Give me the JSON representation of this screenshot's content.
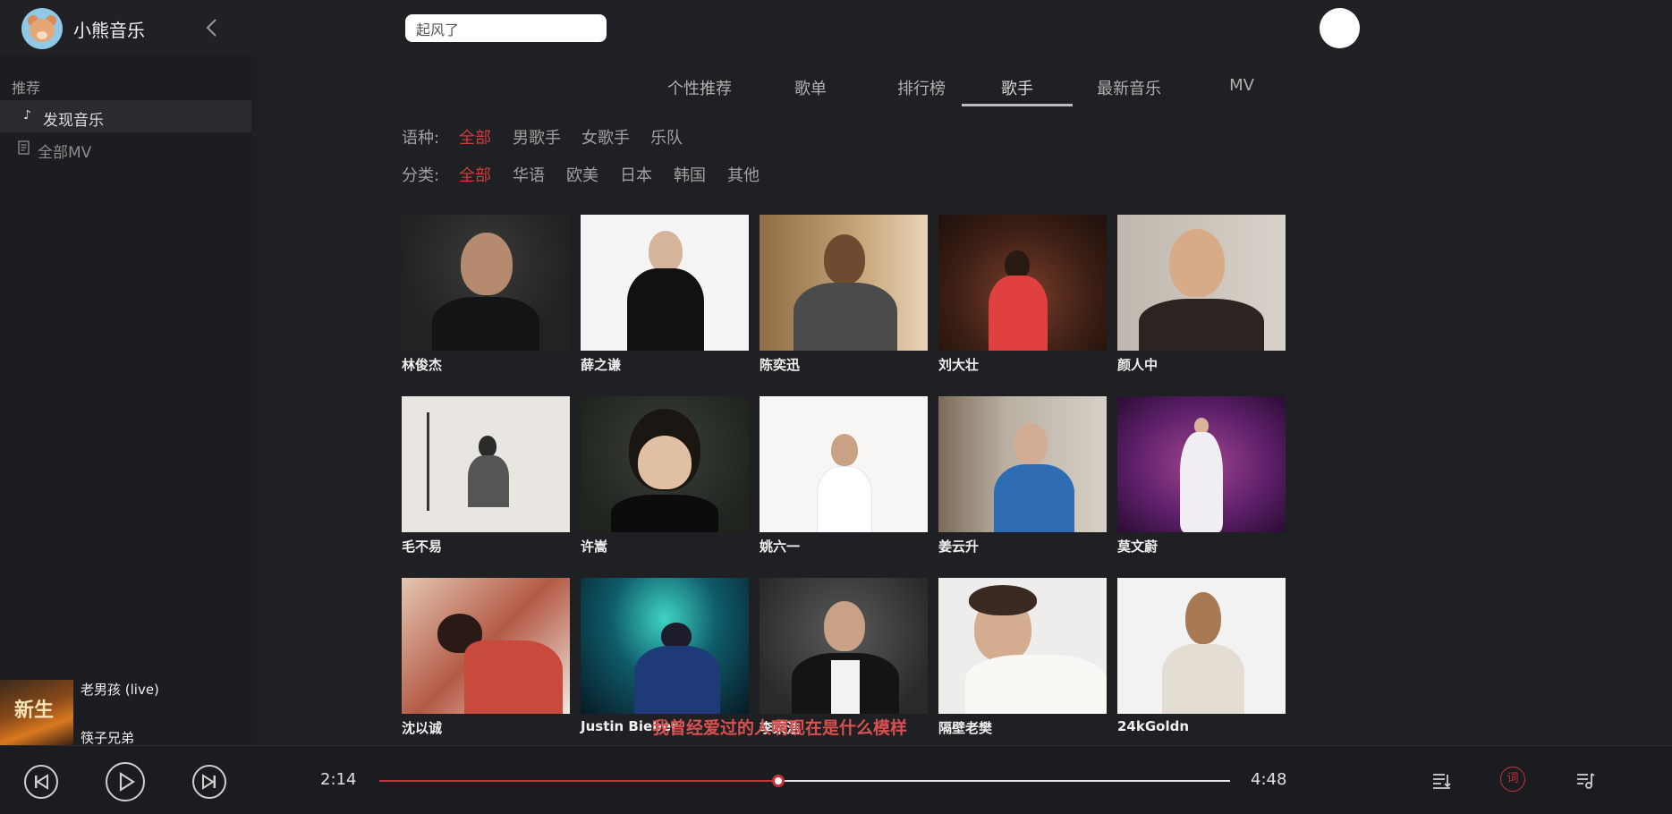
{
  "header": {
    "app_name": "小熊音乐",
    "search": {
      "value": "起风了",
      "placeholder": ""
    }
  },
  "sidebar": {
    "section_title": "推荐",
    "items": [
      {
        "label": "发现音乐",
        "icon": "music-note-icon",
        "active": true
      },
      {
        "label": "全部MV",
        "icon": "document-icon",
        "active": false
      }
    ]
  },
  "tabs": [
    {
      "label": "个性推荐",
      "active": false
    },
    {
      "label": "歌单",
      "active": false
    },
    {
      "label": "排行榜",
      "active": false
    },
    {
      "label": "歌手",
      "active": true
    },
    {
      "label": "最新音乐",
      "active": false
    },
    {
      "label": "MV",
      "active": false
    }
  ],
  "filters": {
    "language": {
      "label": "语种:",
      "options": [
        "全部",
        "男歌手",
        "女歌手",
        "乐队"
      ],
      "selected": "全部"
    },
    "category": {
      "label": "分类:",
      "options": [
        "全部",
        "华语",
        "欧美",
        "日本",
        "韩国",
        "其他"
      ],
      "selected": "全部"
    }
  },
  "artists": [
    {
      "name": "林俊杰"
    },
    {
      "name": "薛之谦"
    },
    {
      "name": "陈奕迅"
    },
    {
      "name": "刘大壮"
    },
    {
      "name": "颜人中"
    },
    {
      "name": "毛不易"
    },
    {
      "name": "许嵩"
    },
    {
      "name": "姚六一"
    },
    {
      "name": "姜云升"
    },
    {
      "name": "莫文蔚"
    },
    {
      "name": "沈以诚"
    },
    {
      "name": "Justin Bieber"
    },
    {
      "name": "李荣浩"
    },
    {
      "name": "隔壁老樊"
    },
    {
      "name": "24kGoldn"
    }
  ],
  "lyric_line": "我曾经爱过的人啊现在是什么模样",
  "now_playing": {
    "title": "老男孩 (live)",
    "artist": "筷子兄弟",
    "cover_text": "新生"
  },
  "player": {
    "current_time": "2:14",
    "total_time": "4:48",
    "progress": 0.4685,
    "lyric_button": "词",
    "accent_color": "#c8323a"
  }
}
